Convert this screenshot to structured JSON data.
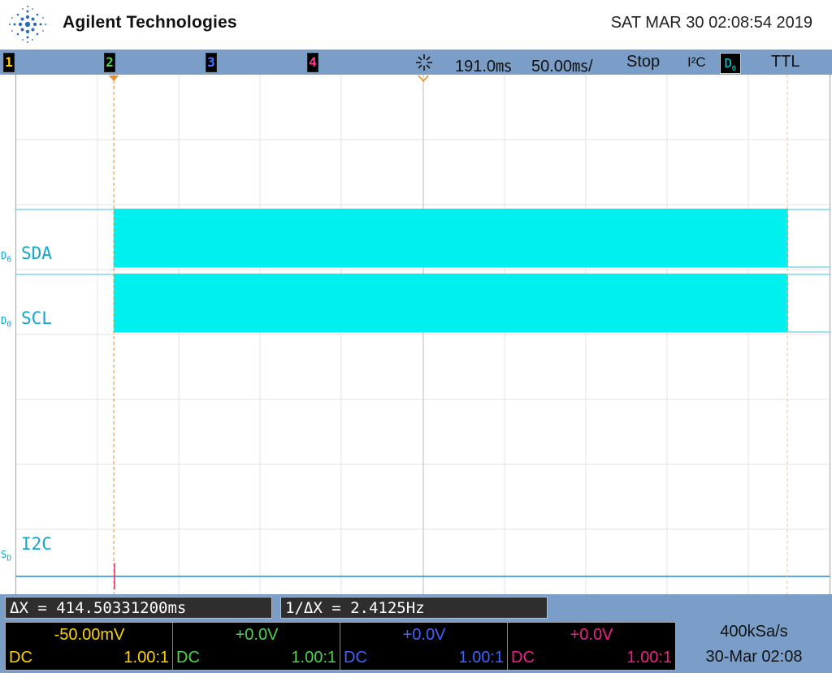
{
  "header": {
    "brand": "Agilent Technologies",
    "datetime": "SAT MAR 30 02:08:54 2019"
  },
  "statusbar": {
    "channels": [
      "1",
      "2",
      "3",
      "4"
    ],
    "time_delay": "191.0㎳",
    "time_scale": "50.00㎳/",
    "run_state": "Stop",
    "protocol": "I²C",
    "trigger_source": "D",
    "trigger_source_sub": "0",
    "trigger_level": "TTL"
  },
  "screen": {
    "signals": [
      {
        "prefix": "D",
        "sub": "6",
        "name": "SDA"
      },
      {
        "prefix": "D",
        "sub": "0",
        "name": "SCL"
      },
      {
        "prefix": "S",
        "sub": "D",
        "name": "I2C"
      }
    ]
  },
  "measurements": {
    "delta_x": "ΔX = 414.50331200ms",
    "inverse_delta_x": "1/ΔX = 2.4125Hz"
  },
  "channels_panel": [
    {
      "offset": "-50.00mV",
      "coupling": "DC",
      "ratio": "1.00:1",
      "color": "#ffd200"
    },
    {
      "offset": "+0.0V",
      "coupling": "DC",
      "ratio": "1.00:1",
      "color": "#4fd24f"
    },
    {
      "offset": "+0.0V",
      "coupling": "DC",
      "ratio": "1.00:1",
      "color": "#3f63ff"
    },
    {
      "offset": "+0.0V",
      "coupling": "DC",
      "ratio": "1.00:1",
      "color": "#f01f88"
    }
  ],
  "acquisition": {
    "sample_rate": "400kSa/s",
    "date": "30-Mar 02:08"
  },
  "colors": {
    "status_bar": "#7b9ec9",
    "digital_trace": "#00f0f0",
    "bus_line": "#1e8fd0"
  }
}
